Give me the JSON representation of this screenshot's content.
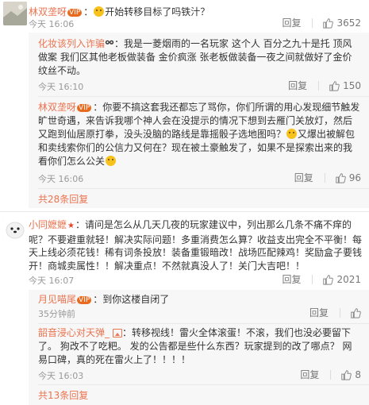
{
  "reply_label": "回复",
  "thread_1": {
    "comment": {
      "username": "林双垄呀",
      "badge": "VIP",
      "text": "开始转移目标了吗铁汁？",
      "time": "今天 16:06",
      "likes": "3652"
    },
    "replies": [
      {
        "username": "化妆该列入诈骗",
        "text": "我是一菱烟雨的一名玩家 这个人 百分之九十是托  顶风做案 我们区其他老板做装备 金价疯涨 张老板做装备一夜之间就做好了金价纹丝不动。",
        "time": "今天 16:10",
        "likes": "150"
      },
      {
        "username": "林双垄呀",
        "badge": "VIP",
        "text_a": "你要不搞这套我还都忘了骂你，你们所谓的用心发现细节触发旷世奇遇，来告诉我哪个神人会在没提示的情况下想到去雁门关放灯，然后又跑到仙居原打拳，没头没脑的路线是靠摇骰子选地图吗？",
        "text_b": "又爆出被解包和卖线索你们的公信力又何在？现在被土豪触发了，如果不是探索出来的我看你们怎么公关",
        "time": "今天 16:06",
        "likes": "96"
      }
    ],
    "more_replies": "共28条回复"
  },
  "thread_2": {
    "comment": {
      "username": "小同嬷嬷",
      "text": "请问是怎么从几天几夜的玩家建议中，列出那么几条不痛不痒的呢？不要避重就轻！解决实际问题！多重消费怎么算？收益支出完全不平衡！每天上线必须花钱！稀有词条投放！装备重锻暗改！战场匹配辣鸡！奖励盒子要钱开！商城卖属性！！解决重点！不然就真没人了！关门大吉吧！！",
      "time": "今天 16:07",
      "likes": "2021"
    },
    "replies": [
      {
        "username": "月见喵尾",
        "badge": "VIP",
        "text": "到你这楼自闭了",
        "time": "35分钟前"
      },
      {
        "username": "韶音浸心对天弹_",
        "text": "转移视线！雷火全体滚蛋！不滚，我们也没必要留下了。 狗改不了吃粑。  发的公告都是些什么东西？玩家提到的改了哪点？   网易口碑，真的死在雷火上了！！！！",
        "time": "今天 16:03",
        "likes": "8"
      }
    ],
    "more_replies": "共13条回复"
  }
}
